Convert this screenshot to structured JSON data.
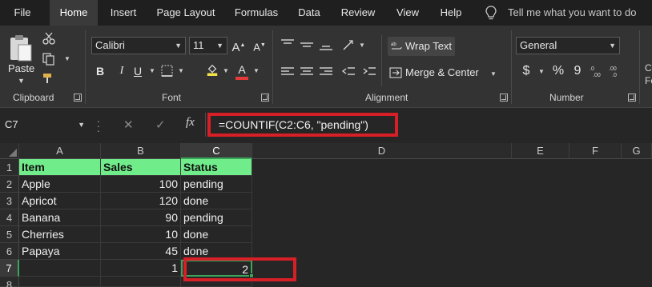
{
  "menu": {
    "tabs": [
      "File",
      "Home",
      "Insert",
      "Page Layout",
      "Formulas",
      "Data",
      "Review",
      "View",
      "Help"
    ],
    "active_tab": "Home",
    "tell_me": "Tell me what you want to do"
  },
  "ribbon": {
    "clipboard": {
      "paste": "Paste",
      "label": "Clipboard"
    },
    "font": {
      "name": "Calibri",
      "size": "11",
      "bold": "B",
      "italic": "I",
      "underline": "U",
      "font_color_letter": "A",
      "label": "Font",
      "fill_color": "#f2e04a",
      "font_color": "#e43a3a"
    },
    "alignment": {
      "wrap_text": "Wrap Text",
      "merge_center": "Merge & Center",
      "label": "Alignment"
    },
    "number": {
      "format": "General",
      "currency": "$",
      "percent": "%",
      "comma": "9",
      "label": "Number"
    },
    "cut_off_right": [
      "C",
      "Fo"
    ]
  },
  "formula_bar": {
    "name_box": "C7",
    "cancel": "✕",
    "enter": "✓",
    "fx": "fx",
    "formula": "=COUNTIF(C2:C6, \"pending\")"
  },
  "sheet": {
    "columns": [
      "A",
      "B",
      "C",
      "D",
      "E",
      "F",
      "G"
    ],
    "selected_column": "C",
    "rows": [
      "1",
      "2",
      "3",
      "4",
      "5",
      "6",
      "7",
      "8"
    ],
    "selected_row": "7",
    "header_row": [
      "Item",
      "Sales",
      "Status"
    ],
    "data": [
      [
        "Apple",
        "100",
        "pending"
      ],
      [
        "Apricot",
        "120",
        "done"
      ],
      [
        "Banana",
        "90",
        "pending"
      ],
      [
        "Cherries",
        "10",
        "done"
      ],
      [
        "Papaya",
        "45",
        "done"
      ]
    ],
    "row7": {
      "b": "1",
      "c": "2"
    },
    "header_fill": "#71ec8b",
    "selection_color": "#3ca55c",
    "highlight_color": "#d61f26"
  }
}
